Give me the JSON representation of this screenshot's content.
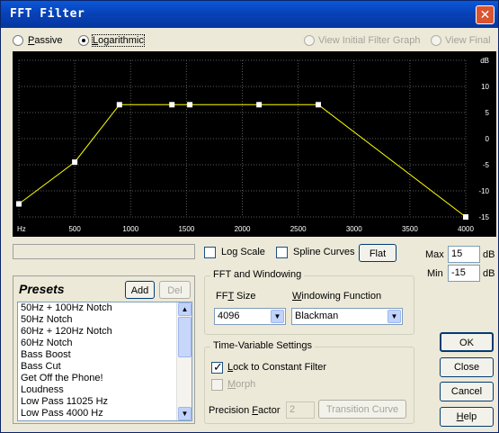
{
  "window": {
    "title": "FFT Filter",
    "close_glyph": "✕"
  },
  "mode": {
    "passive": {
      "prefix": "P",
      "rest": "assive",
      "selected": false
    },
    "logarithmic": {
      "prefix": "L",
      "rest": "ogarithmic",
      "selected": true
    },
    "view_initial": {
      "text": "View Initial Filter Graph",
      "enabled": false
    },
    "view_final": {
      "text": "View Final",
      "enabled": false
    }
  },
  "chart_data": {
    "type": "line",
    "x_scale": "log",
    "xlim": [
      0,
      4000
    ],
    "ylim": [
      -15,
      15
    ],
    "x_ticks": [
      "Hz",
      "500",
      "1000",
      "1500",
      "2000",
      "2500",
      "3000",
      "3500",
      "4000"
    ],
    "x_tick_values": [
      0,
      500,
      1000,
      1500,
      2000,
      2500,
      3000,
      3500,
      4000
    ],
    "y_ticks": [
      "dB",
      "10",
      "5",
      "0",
      "-5",
      "-10",
      "-15"
    ],
    "y_tick_values": [
      15,
      10,
      5,
      0,
      -5,
      -10,
      -15
    ],
    "x": [
      0,
      500,
      900,
      1370,
      1530,
      2150,
      2680,
      4000
    ],
    "y": [
      -12.5,
      -4.5,
      6.5,
      6.5,
      6.5,
      6.5,
      6.5,
      -15
    ],
    "grid": true,
    "colors": {
      "background": "#000000",
      "grid": "#5a5a5a",
      "line": "#ffff00",
      "point": "#ffffff"
    }
  },
  "status_text": "",
  "options": {
    "log_scale": {
      "label": "Log Scale",
      "checked": false
    },
    "spline_curves": {
      "label": "Spline Curves",
      "checked": false
    },
    "flat_button": "Flat"
  },
  "range": {
    "max_label": "Max",
    "max_value": "15",
    "max_unit": "dB",
    "min_label": "Min",
    "min_value": "-15",
    "min_unit": "dB"
  },
  "presets": {
    "title": "Presets",
    "add": "Add",
    "del": "Del",
    "items": [
      "50Hz + 100Hz Notch",
      "50Hz Notch",
      "60Hz + 120Hz Notch",
      "60Hz Notch",
      "Bass Boost",
      "Bass Cut",
      "Get Off the Phone!",
      "Loudness",
      "Low Pass 11025 Hz",
      "Low Pass 4000 Hz"
    ]
  },
  "fft": {
    "title": "FFT and Windowing",
    "size_label_pre": "FF",
    "size_label_u": "T",
    "size_label_post": " Size",
    "size_value": "4096",
    "window_label_pre": "",
    "window_label_u": "W",
    "window_label_post": "indowing Function",
    "window_value": "Blackman"
  },
  "timevar": {
    "title": "Time-Variable Settings",
    "lock_pre": "L",
    "lock_rest": "ock to Constant Filter",
    "lock_checked": true,
    "morph_pre": "M",
    "morph_rest": "orph",
    "morph_checked": false,
    "precision_pre": "Precision ",
    "precision_u": "F",
    "precision_post": "actor",
    "precision_value": "2",
    "transition": "Transition Curve"
  },
  "actions": {
    "ok": "OK",
    "close": "Close",
    "cancel": "Cancel",
    "help_u": "H",
    "help_rest": "elp"
  }
}
